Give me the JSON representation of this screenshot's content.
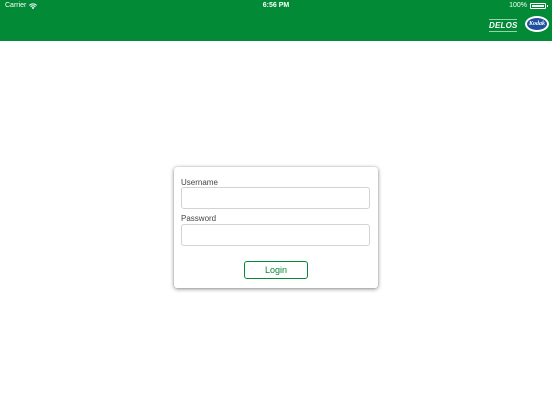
{
  "status_bar": {
    "carrier": "Carrier",
    "time": "6:56 PM",
    "battery": "100%"
  },
  "header": {
    "logo_left_text": "DELOS",
    "logo_right_text": "Kodak",
    "background_color": "#028a36"
  },
  "login": {
    "username_label": "Username",
    "username_value": "",
    "password_label": "Password",
    "password_value": "",
    "login_button_label": "Login",
    "accent_color": "#028a36"
  }
}
